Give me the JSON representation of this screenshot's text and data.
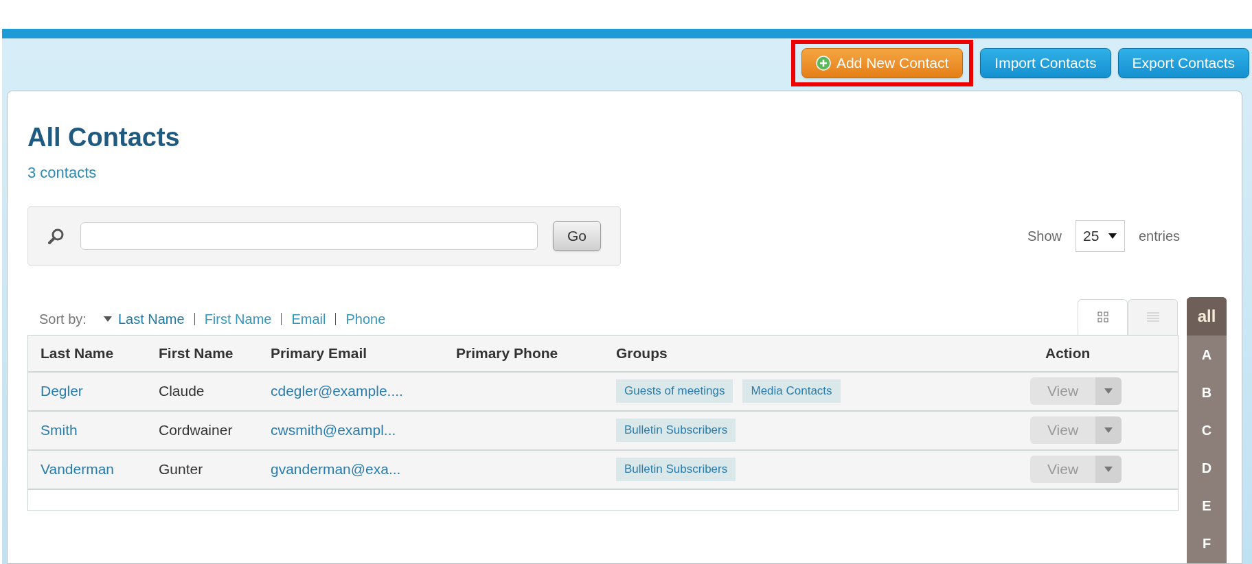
{
  "toolbar": {
    "buttons": [
      {
        "label": "Add New Contact",
        "kind": "primary",
        "highlighted": true
      },
      {
        "label": "Import Contacts",
        "kind": "secondary",
        "highlighted": false
      },
      {
        "label": "Export Contacts",
        "kind": "secondary",
        "highlighted": false
      }
    ]
  },
  "heading": {
    "title": "All Contacts",
    "count": "3 contacts"
  },
  "search": {
    "button": "Go"
  },
  "page_size": {
    "label": "Show",
    "value": "25",
    "suffix": "entries"
  },
  "sort": {
    "label": "Sort by:",
    "options": [
      {
        "label": "Last Name",
        "selected": true
      },
      {
        "label": "First Name",
        "selected": false
      },
      {
        "label": "Email",
        "selected": false
      },
      {
        "label": "Phone",
        "selected": false
      }
    ]
  },
  "view_toggle": [
    {
      "kind": "grid",
      "selected": true
    },
    {
      "kind": "list",
      "selected": false
    }
  ],
  "table": {
    "columns": [
      "Last Name",
      "First Name",
      "Primary Email",
      "Primary Phone",
      "Groups",
      "Action"
    ],
    "rows": [
      {
        "last_name": "Degler",
        "first_name": "Claude",
        "email": "cdegler@example....",
        "phone": "",
        "groups": [
          "Guests of meetings",
          "Media Contacts"
        ],
        "action": "View"
      },
      {
        "last_name": "Smith",
        "first_name": "Cordwainer",
        "email": "cwsmith@exampl...",
        "phone": "",
        "groups": [
          "Bulletin Subscribers"
        ],
        "action": "View"
      },
      {
        "last_name": "Vanderman",
        "first_name": "Gunter",
        "email": "gvanderman@exa...",
        "phone": "",
        "groups": [
          "Bulletin Subscribers"
        ],
        "action": "View"
      }
    ]
  },
  "alphabet": [
    {
      "label": "all",
      "selected": true
    },
    {
      "label": "A",
      "selected": false
    },
    {
      "label": "B",
      "selected": false
    },
    {
      "label": "C",
      "selected": false
    },
    {
      "label": "D",
      "selected": false
    },
    {
      "label": "E",
      "selected": false
    },
    {
      "label": "F",
      "selected": false
    }
  ]
}
